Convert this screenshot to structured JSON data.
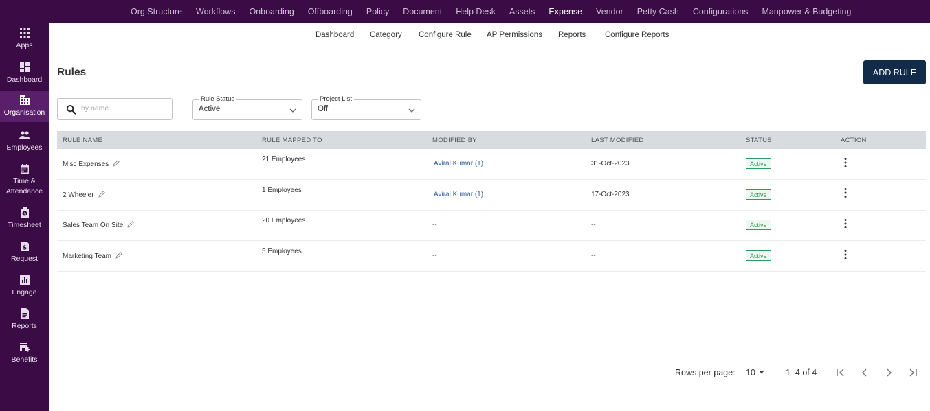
{
  "topnav": [
    "Org Structure",
    "Workflows",
    "Onboarding",
    "Offboarding",
    "Policy",
    "Document",
    "Help Desk",
    "Assets",
    "Expense",
    "Vendor",
    "Petty Cash",
    "Configurations",
    "Manpower & Budgeting"
  ],
  "topnav_active": "Expense",
  "sidebar": [
    {
      "label": "Apps",
      "icon": "apps-grid-icon"
    },
    {
      "label": "Dashboard",
      "icon": "dashboard-icon"
    },
    {
      "label": "Organisation",
      "icon": "building-icon",
      "active": true
    },
    {
      "label": "Employees",
      "icon": "people-icon"
    },
    {
      "label": "Time & Attendance",
      "icon": "calendar-icon"
    },
    {
      "label": "Timesheet",
      "icon": "timesheet-icon"
    },
    {
      "label": "Request",
      "icon": "request-dollar-icon"
    },
    {
      "label": "Engage",
      "icon": "chart-icon"
    },
    {
      "label": "Reports",
      "icon": "report-icon"
    },
    {
      "label": "Benefits",
      "icon": "benefits-icon"
    }
  ],
  "subnav": [
    "Dashboard",
    "Category",
    "Configure Rule",
    "AP Permissions",
    "Reports",
    "Configure Reports"
  ],
  "subnav_active": "Configure Rule",
  "page_title": "Rules",
  "add_button": "ADD RULE",
  "search": {
    "placeholder": "by name",
    "value": ""
  },
  "filters": {
    "rule_status": {
      "label": "Rule Status",
      "value": "Active"
    },
    "project_list": {
      "label": "Project List",
      "value": "Off"
    }
  },
  "table": {
    "headers": [
      "RULE NAME",
      "RULE MAPPED TO",
      "MODIFIED BY",
      "LAST MODIFIED",
      "STATUS",
      "ACTION"
    ],
    "rows": [
      {
        "name": "Misc Expenses",
        "mapped": "21 Employees",
        "modified_by": "Aviral Kumar (1)",
        "last_modified": "31-Oct-2023",
        "status": "Active"
      },
      {
        "name": "2 Wheeler",
        "mapped": "1 Employees",
        "modified_by": "Aviral Kumar (1)",
        "last_modified": "17-Oct-2023",
        "status": "Active"
      },
      {
        "name": "Sales Team On Site",
        "mapped": "20 Employees",
        "modified_by": "--",
        "last_modified": "--",
        "status": "Active"
      },
      {
        "name": "Marketing Team",
        "mapped": "5 Employees",
        "modified_by": "--",
        "last_modified": "--",
        "status": "Active"
      }
    ]
  },
  "pagination": {
    "rows_per_page_label": "Rows per page:",
    "rows_per_page": "10",
    "range": "1–4 of 4"
  },
  "colors": {
    "brand": "#3b0b46",
    "primary_button": "#122b4a",
    "active_status": "#2e9a5c",
    "link": "#2d5f9e"
  }
}
